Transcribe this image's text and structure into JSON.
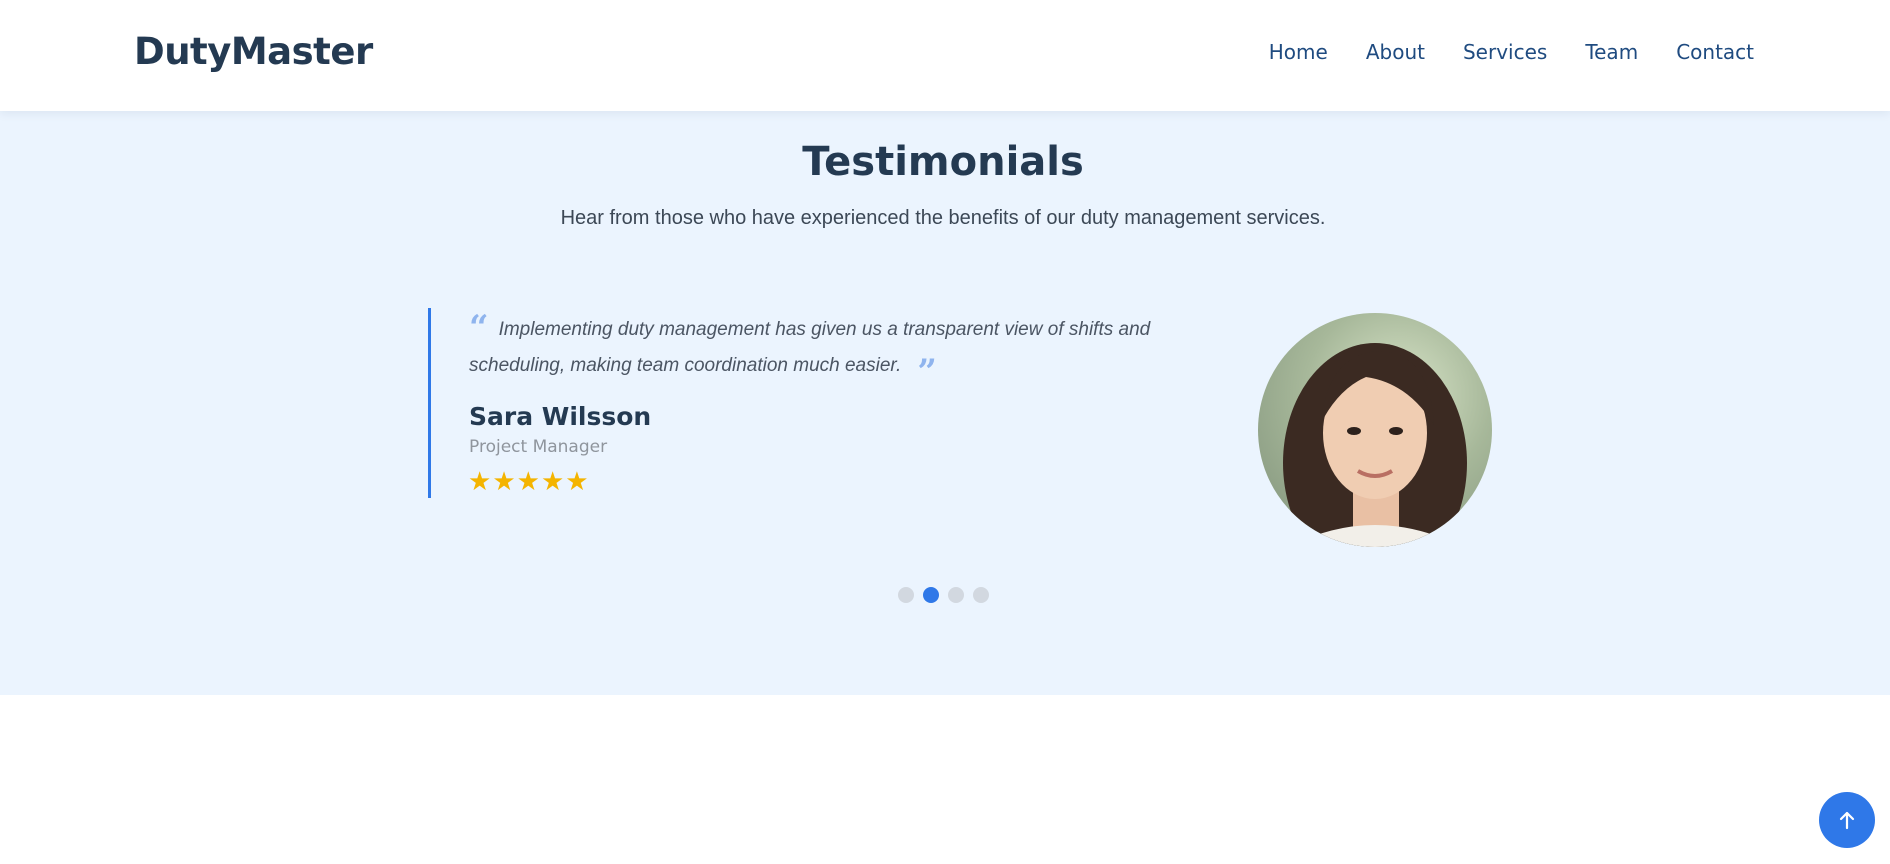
{
  "header": {
    "logo": "DutyMaster",
    "nav": [
      "Home",
      "About",
      "Services",
      "Team",
      "Contact"
    ]
  },
  "testimonials": {
    "title": "Testimonials",
    "subtitle": "Hear from those who have experienced the benefits of our duty management services.",
    "active": {
      "quote": "Implementing duty management has given us a transparent view of shifts and scheduling, making team coordination much easier.",
      "name": "Sara Wilsson",
      "role": "Project Manager",
      "rating": 5,
      "rating_max": 5
    },
    "pagination": {
      "count": 4,
      "active_index": 1
    }
  },
  "colors": {
    "accent": "#2f78e8",
    "section_bg": "#ebf4fe",
    "heading": "#243a52",
    "nav_text": "#1f4b80",
    "star": "#f4b400",
    "dot_inactive": "#d2d8e0"
  },
  "icons": {
    "quote_open": "quote-open-icon",
    "quote_close": "quote-close-icon",
    "star": "star-icon",
    "back_to_top": "arrow-up-icon"
  }
}
